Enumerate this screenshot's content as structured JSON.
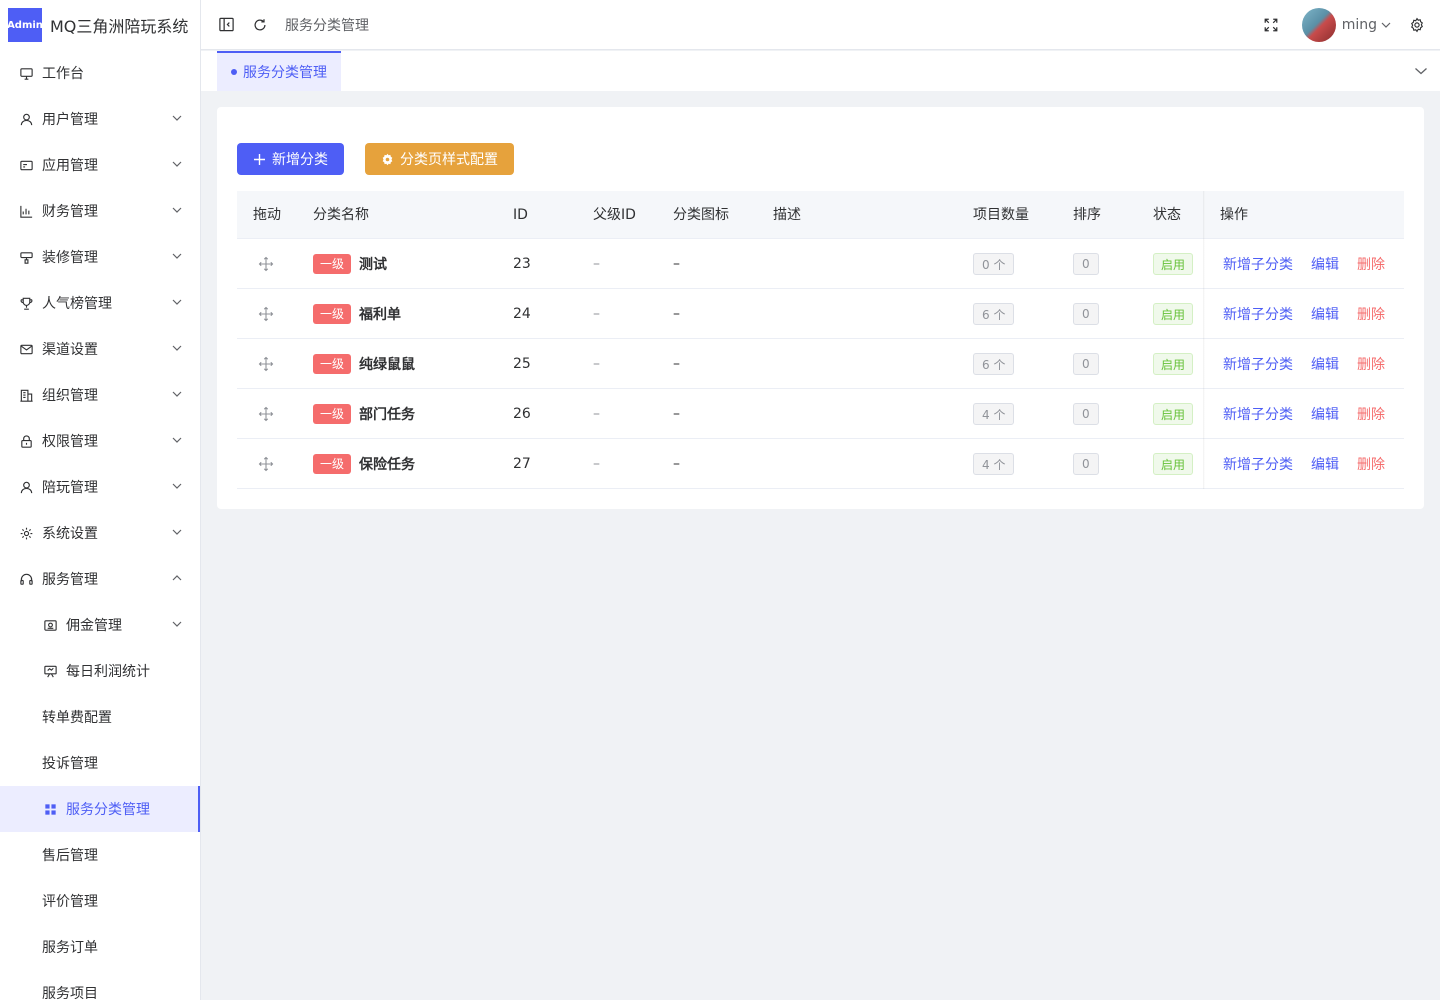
{
  "app": {
    "logo_badge": "Admin",
    "title": "MQ三角洲陪玩系统"
  },
  "sidebar": {
    "items": [
      {
        "label": "工作台",
        "icon": "monitor-icon"
      },
      {
        "label": "用户管理",
        "icon": "user-icon"
      },
      {
        "label": "应用管理",
        "icon": "app-card-icon"
      },
      {
        "label": "财务管理",
        "icon": "chart-icon"
      },
      {
        "label": "装修管理",
        "icon": "brush-icon"
      },
      {
        "label": "人气榜管理",
        "icon": "trophy-icon"
      },
      {
        "label": "渠道设置",
        "icon": "mail-icon"
      },
      {
        "label": "组织管理",
        "icon": "building-icon"
      },
      {
        "label": "权限管理",
        "icon": "lock-icon"
      },
      {
        "label": "陪玩管理",
        "icon": "user-icon"
      },
      {
        "label": "系统设置",
        "icon": "gear-icon"
      },
      {
        "label": "服务管理",
        "icon": "headset-icon"
      }
    ],
    "sub_items": [
      {
        "label": "佣金管理",
        "icon": "wallet-icon"
      },
      {
        "label": "每日利润统计",
        "icon": "easel-icon"
      },
      {
        "label": "转单费配置"
      },
      {
        "label": "投诉管理"
      },
      {
        "label": "服务分类管理",
        "icon": "grid-icon"
      },
      {
        "label": "售后管理"
      },
      {
        "label": "评价管理"
      },
      {
        "label": "服务订单"
      },
      {
        "label": "服务项目"
      }
    ]
  },
  "header": {
    "breadcrumb": "服务分类管理",
    "username": "ming"
  },
  "tabs": [
    {
      "label": "服务分类管理"
    }
  ],
  "toolbar": {
    "add_label": "新增分类",
    "config_label": "分类页样式配置"
  },
  "table": {
    "columns": [
      "拖动",
      "分类名称",
      "ID",
      "父级ID",
      "分类图标",
      "描述",
      "项目数量",
      "排序",
      "状态",
      "操作"
    ],
    "rows": [
      {
        "level": "一级",
        "name": "测试",
        "id": "23",
        "parent_id": "–",
        "icon": "–",
        "count": "0 个",
        "sort": "0",
        "status": "启用"
      },
      {
        "level": "一级",
        "name": "福利单",
        "id": "24",
        "parent_id": "–",
        "icon": "–",
        "count": "6 个",
        "sort": "0",
        "status": "启用"
      },
      {
        "level": "一级",
        "name": "纯绿鼠鼠",
        "id": "25",
        "parent_id": "–",
        "icon": "–",
        "count": "6 个",
        "sort": "0",
        "status": "启用"
      },
      {
        "level": "一级",
        "name": "部门任务",
        "id": "26",
        "parent_id": "–",
        "icon": "–",
        "count": "4 个",
        "sort": "0",
        "status": "启用"
      },
      {
        "level": "一级",
        "name": "保险任务",
        "id": "27",
        "parent_id": "–",
        "icon": "–",
        "count": "4 个",
        "sort": "0",
        "status": "启用"
      }
    ],
    "actions": {
      "add_child": "新增子分类",
      "edit": "编辑",
      "delete": "删除"
    }
  },
  "colors": {
    "primary": "#4e5ef5",
    "warning": "#e6a23c",
    "danger": "#f56c6c",
    "success": "#67c23a"
  }
}
